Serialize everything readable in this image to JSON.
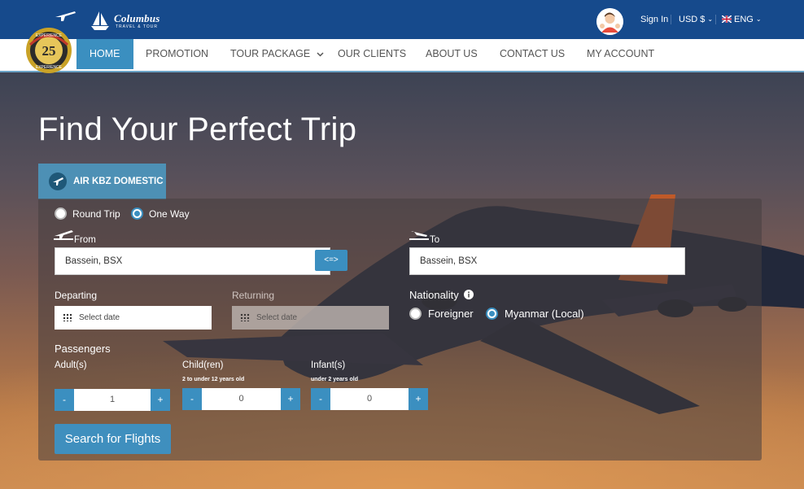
{
  "brand": {
    "name": "Columbus",
    "subtitle": "TRAVEL & TOUR",
    "badge_number": "25",
    "badge_text": "EXPERIENCE"
  },
  "topbar": {
    "sign_in": "Sign In",
    "currency": "USD $",
    "language": "ENG"
  },
  "nav": {
    "items": [
      {
        "label": "HOME",
        "active": true
      },
      {
        "label": "PROMOTION"
      },
      {
        "label": "TOUR PACKAGE"
      },
      {
        "label": "OUR CLIENTS"
      },
      {
        "label": "ABOUT US"
      },
      {
        "label": "CONTACT US"
      },
      {
        "label": "MY ACCOUNT"
      }
    ]
  },
  "hero": {
    "title": "Find Your Perfect Trip"
  },
  "search": {
    "tab_label": "AIR KBZ DOMESTIC",
    "trip_types": {
      "round_trip": "Round Trip",
      "one_way": "One Way",
      "selected": "One Way"
    },
    "from": {
      "label": "From",
      "value": "Bassein, BSX"
    },
    "to": {
      "label": "To",
      "value": "Bassein, BSX"
    },
    "swap_label": "<=>",
    "departing": {
      "label": "Departing",
      "placeholder": "Select date"
    },
    "returning": {
      "label": "Returning",
      "placeholder": "Select date"
    },
    "nationality": {
      "label": "Nationality",
      "foreigner": "Foreigner",
      "local": "Myanmar (Local)",
      "selected": "Myanmar (Local)"
    },
    "passengers": {
      "label": "Passengers",
      "adult": {
        "label": "Adult(s)",
        "value": "1"
      },
      "child": {
        "label": "Child(ren)",
        "note": "2 to under 12 years old",
        "value": "0"
      },
      "infant": {
        "label": "Infant(s)",
        "note": "under 2 years old",
        "value": "0"
      },
      "minus": "-",
      "plus": "+"
    },
    "submit": "Search for Flights"
  },
  "colors": {
    "header": "#164a8c",
    "accent": "#3b8fc0"
  }
}
